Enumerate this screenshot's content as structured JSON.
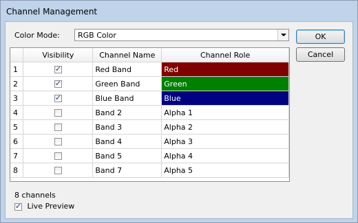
{
  "window": {
    "title": "Channel Management"
  },
  "color_mode": {
    "label": "Color Mode:",
    "value": "RGB Color"
  },
  "buttons": {
    "ok": "OK",
    "cancel": "Cancel"
  },
  "table": {
    "columns": [
      "",
      "Visibility",
      "Channel Name",
      "Channel Role"
    ],
    "rows": [
      {
        "index": "1",
        "visible": true,
        "name": "Red Band",
        "role": "Red",
        "role_color": "#800000"
      },
      {
        "index": "2",
        "visible": true,
        "name": "Green Band",
        "role": "Green",
        "role_color": "#008000"
      },
      {
        "index": "3",
        "visible": true,
        "name": "Blue Band",
        "role": "Blue",
        "role_color": "#000080"
      },
      {
        "index": "4",
        "visible": false,
        "name": "Band 2",
        "role": "Alpha 1",
        "role_color": ""
      },
      {
        "index": "5",
        "visible": false,
        "name": "Band 3",
        "role": "Alpha 2",
        "role_color": ""
      },
      {
        "index": "6",
        "visible": false,
        "name": "Band 4",
        "role": "Alpha 3",
        "role_color": ""
      },
      {
        "index": "7",
        "visible": false,
        "name": "Band 5",
        "role": "Alpha 4",
        "role_color": ""
      },
      {
        "index": "8",
        "visible": false,
        "name": "Band 7",
        "role": "Alpha 5",
        "role_color": ""
      }
    ]
  },
  "status": {
    "channel_count": "8 channels"
  },
  "live_preview": {
    "label": "Live Preview",
    "checked": true
  }
}
